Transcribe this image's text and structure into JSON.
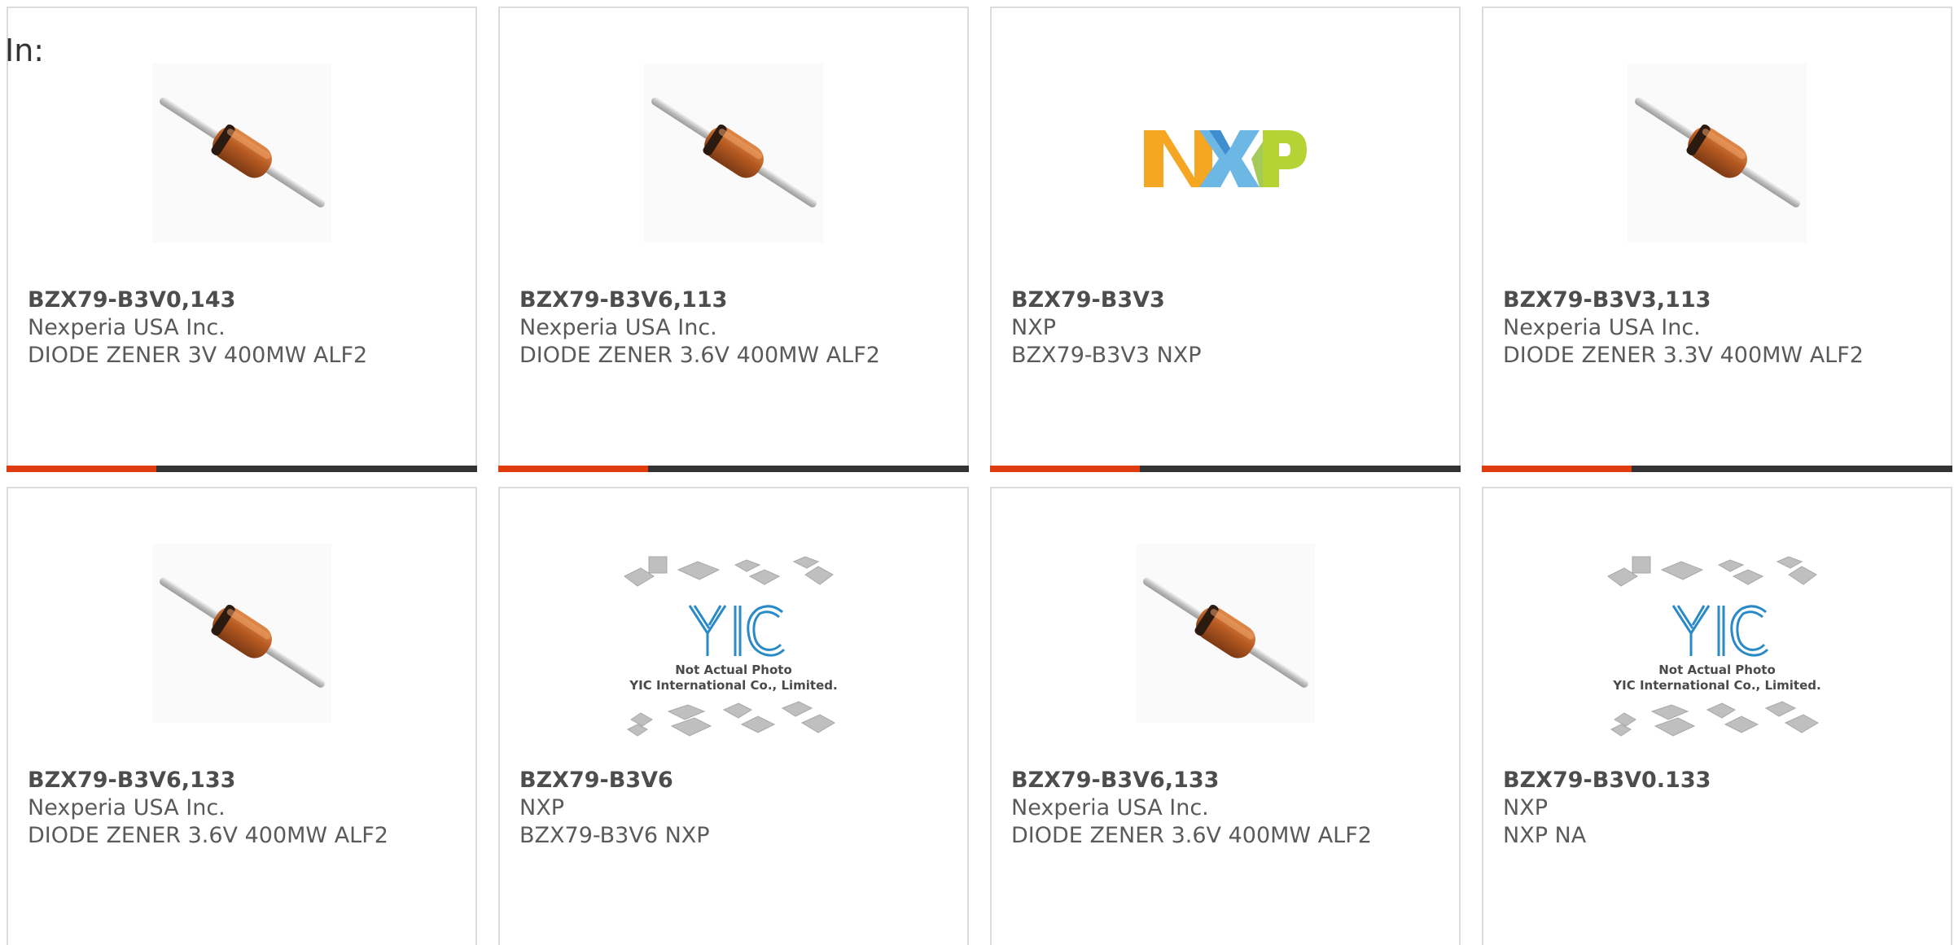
{
  "header": {
    "label": "In:"
  },
  "colors": {
    "accent": "#e03c0f",
    "bar": "#333333",
    "border": "#dcdcdc",
    "text": "#5a5a5a"
  },
  "products": [
    {
      "part": "BZX79-B3V0,143",
      "manufacturer": "Nexperia USA Inc.",
      "description": "DIODE ZENER 3V 400MW ALF2",
      "image": "diode"
    },
    {
      "part": "BZX79-B3V6,113",
      "manufacturer": "Nexperia USA Inc.",
      "description": "DIODE ZENER 3.6V 400MW ALF2",
      "image": "diode"
    },
    {
      "part": "BZX79-B3V3",
      "manufacturer": "NXP",
      "description": "BZX79-B3V3 NXP",
      "image": "nxp-logo"
    },
    {
      "part": "BZX79-B3V3,113",
      "manufacturer": "Nexperia USA Inc.",
      "description": "DIODE ZENER 3.3V 400MW ALF2",
      "image": "diode"
    },
    {
      "part": "BZX79-B3V6,133",
      "manufacturer": "Nexperia USA Inc.",
      "description": "DIODE ZENER 3.6V 400MW ALF2",
      "image": "diode"
    },
    {
      "part": "BZX79-B3V6",
      "manufacturer": "NXP",
      "description": "BZX79-B3V6 NXP",
      "image": "yic-placeholder"
    },
    {
      "part": "BZX79-B3V6,133",
      "manufacturer": "Nexperia USA Inc.",
      "description": "DIODE ZENER 3.6V 400MW ALF2",
      "image": "diode"
    },
    {
      "part": "BZX79-B3V0.133",
      "manufacturer": "NXP",
      "description": "NXP NA",
      "image": "yic-placeholder"
    }
  ],
  "placeholder": {
    "line1": "Not Actual Photo",
    "line2": "YIC International Co., Limited.",
    "logo_text": "YIC"
  },
  "nxp_logo": {
    "text": "NXP"
  }
}
